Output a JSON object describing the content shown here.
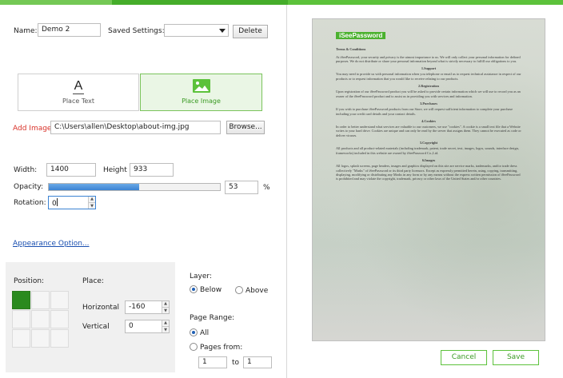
{
  "form": {
    "name_label": "Name:",
    "name_value": "Demo 2",
    "saved_settings_label": "Saved Settings:",
    "saved_settings_value": "",
    "delete_label": "Delete",
    "mode_place_text": "Place Text",
    "mode_place_image": "Place Image",
    "mode_text_glyph": "A",
    "add_image_label": "Add Image:",
    "image_path": "C:\\Users\\allen\\Desktop\\about-img.jpg",
    "browse_label": "Browse...",
    "width_label": "Width:",
    "width_value": "1400",
    "height_label": "Height",
    "height_value": "933",
    "opacity_label": "Opacity:",
    "opacity_value": "53",
    "opacity_percent": 53,
    "percent_sign": "%",
    "rotation_label": "Rotation:",
    "rotation_value": "0",
    "appearance_link": "Appearance Option...",
    "accent_color": "#5cc23b",
    "link_color": "#1a4fb0",
    "error_color": "#d9342b"
  },
  "position_panel": {
    "position_label": "Position:",
    "place_label": "Place:",
    "horizontal_label": "Horizontal",
    "horizontal_value": "-160",
    "vertical_label": "Vertical",
    "vertical_value": "0",
    "selected_cell": "top-left"
  },
  "layer": {
    "label": "Layer:",
    "below": "Below",
    "above": "Above",
    "selected": "Below"
  },
  "page_range": {
    "label": "Page Range:",
    "all": "All",
    "pages_from": "Pages from:",
    "from_value": "1",
    "to_label": "to",
    "to_value": "1",
    "selected": "All"
  },
  "preview": {
    "logo_text": "iSeePassword",
    "doc_title": "Terms & Conditions",
    "intro": "At iSeePassword, your security and privacy is the utmost importance to us. We will only collect your personal information for defined purposes. We do not distribute or share your personal information beyond what is strictly necessary to fulfill our obligations to you.",
    "s1_title": "1.Support",
    "s1_text": "You may need to provide us with personal information when you telephone or email us to request technical assistance in respect of our products or to request information that you would like to receive relating to our products.",
    "s2_title": "2.Registration",
    "s2_text": "Upon registration of our iSeePassword product you will be asked to provide certain information which we will use to record you as an owner of the iSeePassword product and to assist us in providing you with services and information.",
    "s3_title": "3.Purchases",
    "s3_text": "If you wish to purchase iSeePassword products from our Store, we will request sufficient information to complete your purchase including your credit card details and your contact details.",
    "s4_title": "4.Cookies",
    "s4_text": "In order to better understand what services are valuable to our customers, we use \"cookies\". A cookie is a small text file that a Website writes to your hard drive. Cookies are unique and can only be read by the server that assigns them. They cannot be executed as code or deliver viruses.",
    "s5_title": "5.Copyright",
    "s5_text": "All products and all product-related materials (including trademark, patent, trade secret, text, images, logos, sounds, interface design, frameworks) included in this website are owned by iSeePassword Co.,Ltd.",
    "s6_title": "6.Images",
    "s6_text": "All logos, splash screens, page headers, images and graphics displayed on this site are service marks, trademarks, and/or trade dress collectively \"Marks\" of iSeePassword or its third party licensors. Except as expressly permitted herein, using, copying, transmitting, displaying, modifying or distributing any Marks in any form or by any means without the express written permission of iSeePassword is prohibited and may violate the copyright, trademark, privacy or other laws of the United States and/or other countries."
  },
  "footer": {
    "cancel": "Cancel",
    "save": "Save"
  }
}
